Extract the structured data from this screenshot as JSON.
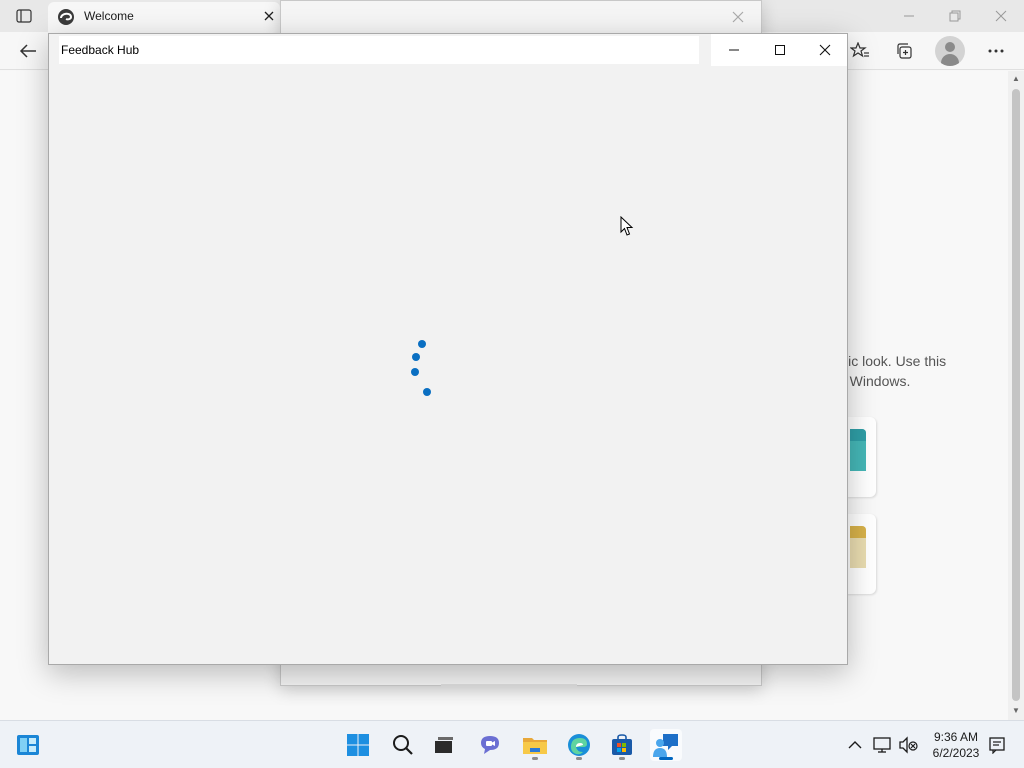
{
  "browser": {
    "tab": {
      "title": "Welcome"
    },
    "content": {
      "promo_line_1": "ylic look. Use this",
      "promo_line_2": "n Windows."
    }
  },
  "feedback_hub": {
    "title": "Feedback Hub",
    "state": "loading"
  },
  "taskbar": {
    "apps": [
      "start",
      "search",
      "task-view",
      "teams-chat",
      "file-explorer",
      "edge",
      "microsoft-store",
      "feedback-hub"
    ],
    "clock": {
      "time": "9:36 AM",
      "date": "6/2/2023"
    }
  },
  "colors": {
    "accent": "#0067c0",
    "spinner": "#0a6fc2",
    "window_bg": "#f2f2f2"
  }
}
